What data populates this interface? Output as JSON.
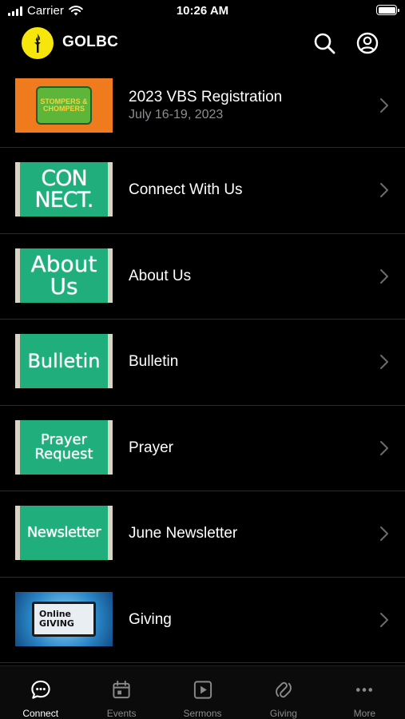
{
  "status_bar": {
    "carrier": "Carrier",
    "time": "10:26 AM"
  },
  "header": {
    "title": "GOLBC"
  },
  "list": [
    {
      "title": "2023 VBS Registration",
      "subtitle": "July 16-19, 2023",
      "thumb_text": "STOMPERS & CHOMPERS"
    },
    {
      "title": "Connect With Us",
      "thumb_text": "CON NECT."
    },
    {
      "title": "About Us",
      "thumb_text": "About Us"
    },
    {
      "title": "Bulletin",
      "thumb_text": "Bulletin"
    },
    {
      "title": "Prayer",
      "thumb_text": "Prayer Request"
    },
    {
      "title": "June Newsletter",
      "thumb_text": "Newsletter"
    },
    {
      "title": "Giving",
      "thumb_text": "Online GIVING"
    }
  ],
  "tabs": [
    {
      "label": "Connect",
      "icon": "chat-bubble-icon",
      "active": true
    },
    {
      "label": "Events",
      "icon": "calendar-icon"
    },
    {
      "label": "Sermons",
      "icon": "play-icon"
    },
    {
      "label": "Giving",
      "icon": "giving-icon"
    },
    {
      "label": "More",
      "icon": "more-icon"
    }
  ],
  "colors": {
    "background": "#000000",
    "logo": "#f6e60b",
    "board_green": "#1fae7c",
    "subtitle": "#8e8e93"
  }
}
